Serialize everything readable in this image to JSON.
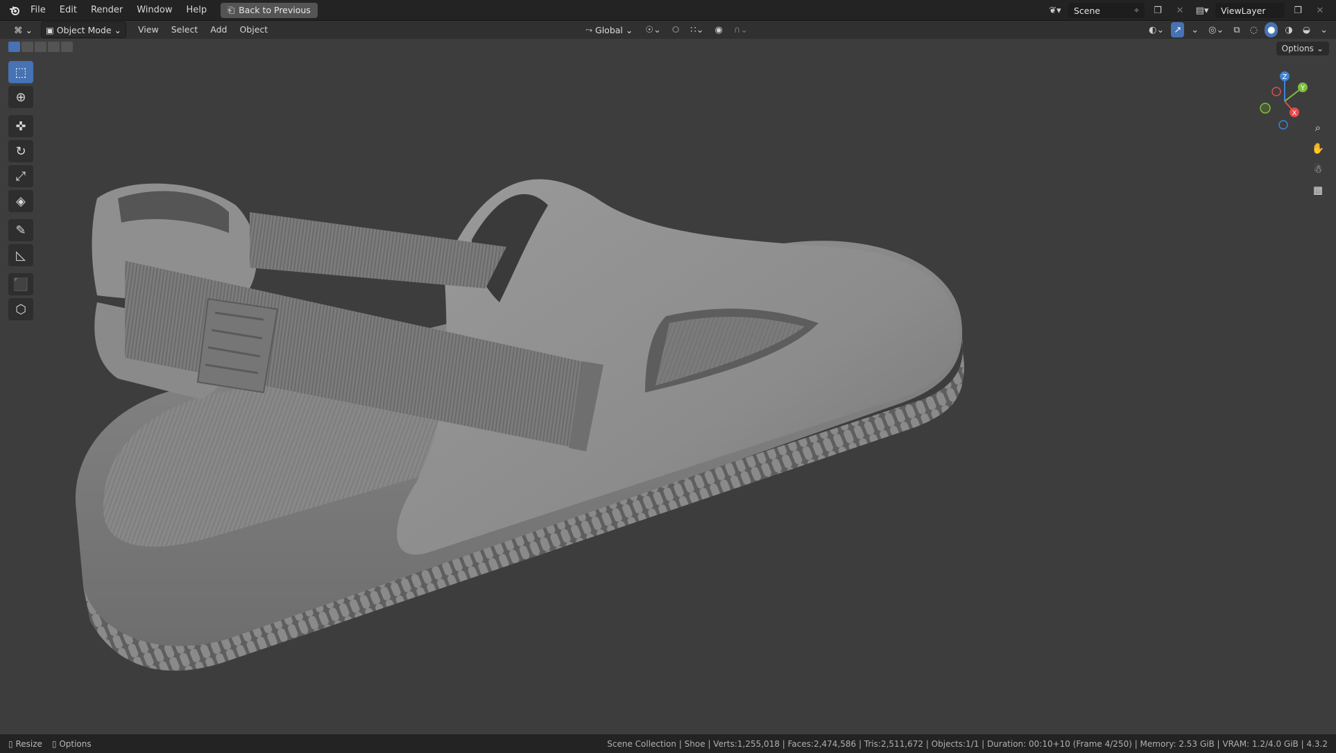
{
  "topbar": {
    "menus": [
      "File",
      "Edit",
      "Render",
      "Window",
      "Help"
    ],
    "back_button": "Back to Previous",
    "scene": "Scene",
    "view_layer": "ViewLayer"
  },
  "header": {
    "mode": "Object Mode",
    "menus": [
      "View",
      "Select",
      "Add",
      "Object"
    ],
    "orientation": "Global"
  },
  "viewport": {
    "options_label": "Options",
    "gizmo_axes": [
      "Z",
      "Y",
      "X"
    ],
    "object_name": "Shoe"
  },
  "toolbar": {
    "tools": [
      {
        "name": "select-box-tool",
        "icon": "select-box-icon"
      },
      {
        "name": "cursor-tool",
        "icon": "cursor-icon"
      },
      {
        "name": "move-tool",
        "icon": "move-icon"
      },
      {
        "name": "rotate-tool",
        "icon": "rotate-icon"
      },
      {
        "name": "scale-tool",
        "icon": "scale-icon"
      },
      {
        "name": "transform-tool",
        "icon": "transform-icon"
      },
      {
        "name": "annotate-tool",
        "icon": "annotate-icon"
      },
      {
        "name": "measure-tool",
        "icon": "measure-icon"
      },
      {
        "name": "add-cube-tool",
        "icon": "add-cube-icon"
      },
      {
        "name": "add-object-tool",
        "icon": "add-object-icon"
      }
    ]
  },
  "statusbar": {
    "left": [
      "Resize",
      "Options"
    ],
    "info": "Scene Collection | Shoe | Verts:1,255,018 | Faces:2,474,586 | Tris:2,511,672 | Objects:1/1 | Duration: 00:10+10 (Frame 4/250) | Memory: 2.53 GiB | VRAM: 1.2/4.0 GiB | 4.3.2"
  },
  "colors": {
    "accent": "#4772b3",
    "viewport_bg": "#3d3d3d",
    "axis_x": "#e64a4a",
    "axis_y": "#7fbf3f",
    "axis_z": "#3a85d9"
  }
}
